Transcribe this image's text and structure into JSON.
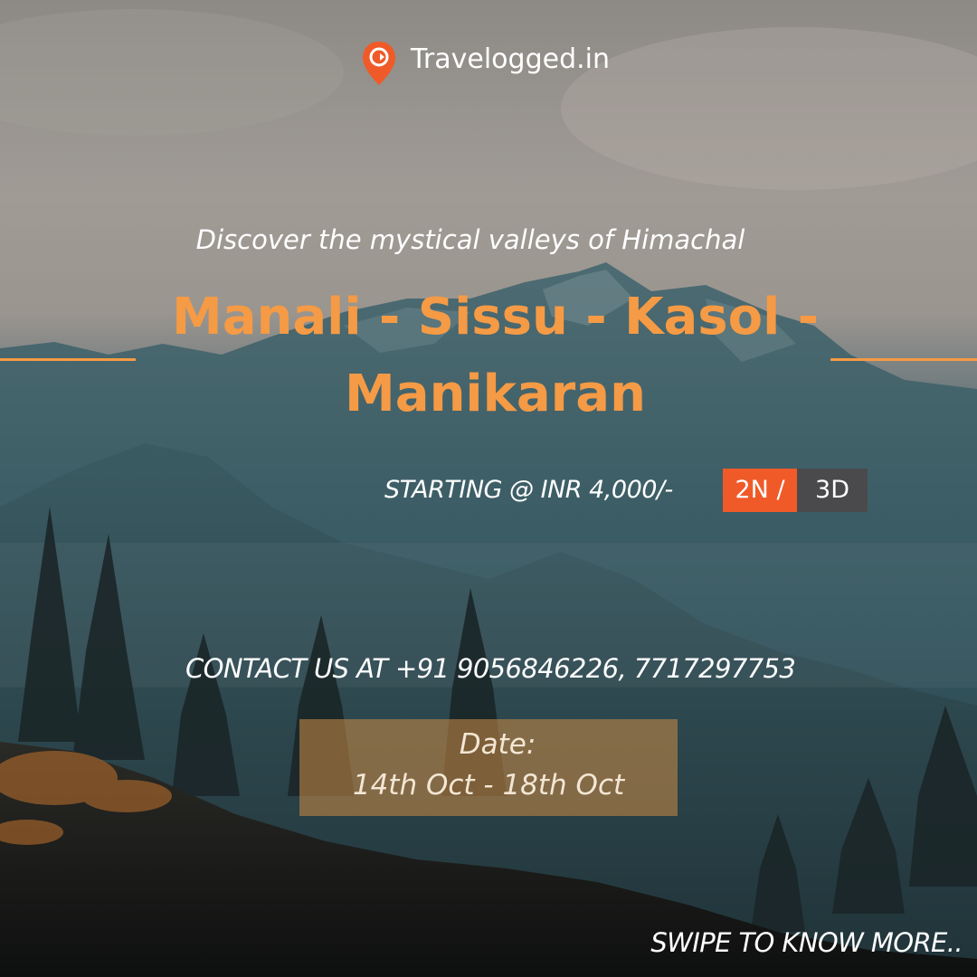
{
  "brand": {
    "name": "Travelogged.in",
    "logo_icon": "location-pin-icon",
    "logo_color": "#f05a28"
  },
  "tagline": "Discover the mystical valleys of Himachal",
  "title": {
    "line1": "Manali -  Sissu - Kasol -",
    "line2": "Manikaran",
    "color": "#f59a45"
  },
  "price": {
    "text": "STARTING @ INR 4,000/-",
    "nights": "2N",
    "separator": "/",
    "days": "3D",
    "nights_bg": "#f05a28",
    "days_bg": "#4a4a4c"
  },
  "contact": "CONTACT US AT +91 9056846226, 7717297753",
  "dates": {
    "label": "Date:",
    "range": "14th Oct - 18th Oct"
  },
  "footer": "SWIPE TO KNOW MORE.."
}
